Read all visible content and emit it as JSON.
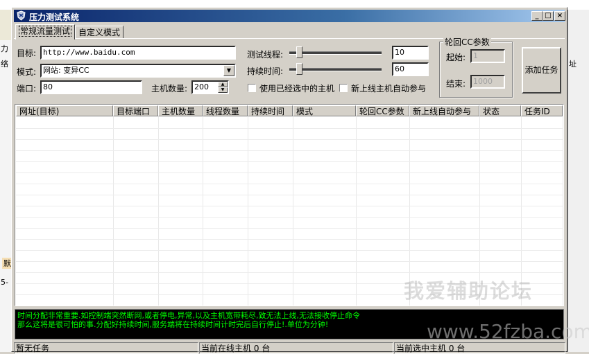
{
  "window": {
    "title": "压力测试系统"
  },
  "tabs": [
    {
      "label": "常规流量测试"
    },
    {
      "label": "自定义模式"
    }
  ],
  "form": {
    "target_label": "目标:",
    "target_value": "http://www.baidu.com",
    "mode_label": "模式:",
    "mode_value": "网站: 变异CC",
    "port_label": "端口:",
    "port_value": "80",
    "hosts_label": "主机数量:",
    "hosts_value": "200",
    "threads_label": "测试线程:",
    "threads_value": "10",
    "duration_label": "持续时间:",
    "duration_value": "60",
    "use_selected_label": "使用已经选中的主机",
    "auto_join_label": "新上线主机自动参与"
  },
  "cc_group": {
    "title": "轮回CC参数",
    "start_label": "起始:",
    "start_value": "1",
    "end_label": "结束:",
    "end_value": "1000"
  },
  "add_task_button": "添加任务",
  "table": {
    "columns": [
      "网址(目标)",
      "目标端口",
      "主机数量",
      "线程数量",
      "持续时间",
      "模式",
      "轮回CC参数",
      "新上线自动参与",
      "状态",
      "任务ID"
    ]
  },
  "log": {
    "lines": [
      "时间分配非常重要.如控制端突然断网,或者停电,异常,以及主机宽带耗尽,致无法上线,无法接收停止命令",
      "那么这将是很可怕的事.分配好持续时间,服务端将在持续时间计时完后自行停止!.单位为分钟!"
    ]
  },
  "watermark": {
    "text1": "我爱辅助论坛",
    "text2": "www.52fzba.com"
  },
  "statusbar": {
    "tasks": "暂无任务",
    "online": "当前在线主机 0 台",
    "selected": "当前选中主机 0 台"
  },
  "background_app": {
    "left_labels": [
      "力",
      "络",
      "默",
      "5-"
    ],
    "right_label": "址"
  },
  "colors": {
    "titlebar_start": "#0a246a",
    "titlebar_end": "#a6caf0",
    "log_text": "#00ff00"
  }
}
